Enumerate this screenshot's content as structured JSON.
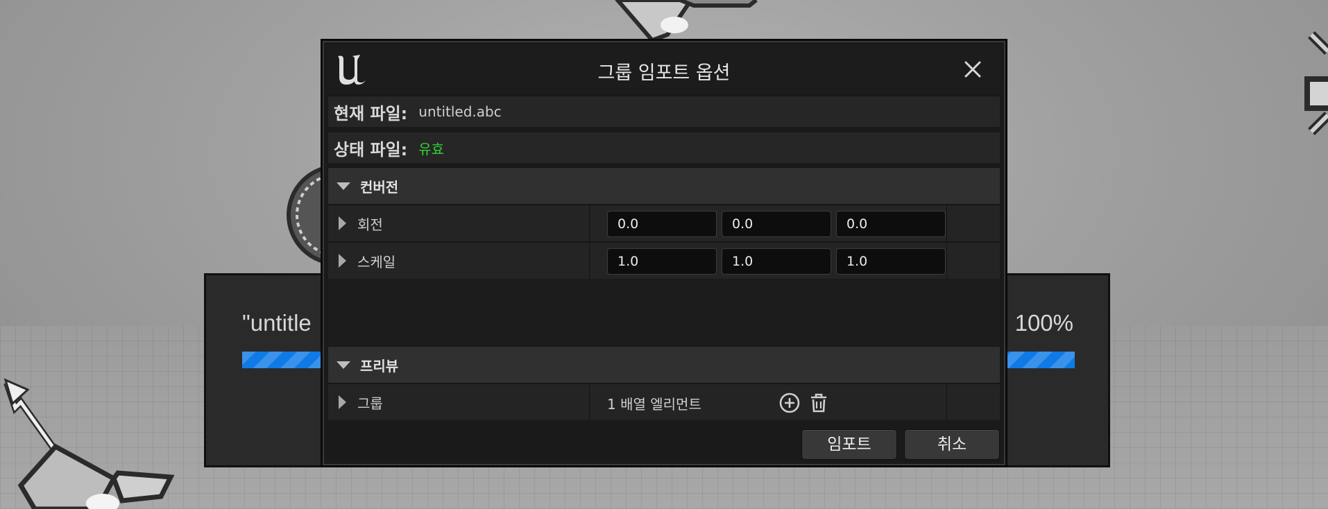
{
  "background": {
    "progress": {
      "title": "\"untitle",
      "percent_label": "100%",
      "percent": 100,
      "bar_color": "#0f7ae5"
    }
  },
  "dialog": {
    "title": "그룹 임포트 옵션",
    "logo_icon": "unreal-engine-logo",
    "close_icon": "close-icon",
    "current_file": {
      "label": "현재 파일:",
      "value": "untitled.abc"
    },
    "file_status": {
      "label": "상태 파일:",
      "value": "유효",
      "value_color": "#2fd12f"
    },
    "conversion": {
      "title": "컨버전",
      "rows": [
        {
          "name": "회전",
          "values": [
            "0.0",
            "0.0",
            "0.0"
          ]
        },
        {
          "name": "스케일",
          "values": [
            "1.0",
            "1.0",
            "1.0"
          ]
        }
      ]
    },
    "preview": {
      "title": "프리뷰",
      "rows": [
        {
          "name": "그룹",
          "value": "1 배열 엘리먼트",
          "add_icon": "add-circle-icon",
          "delete_icon": "trash-icon"
        }
      ]
    },
    "buttons": {
      "import": "임포트",
      "cancel": "취소"
    }
  }
}
